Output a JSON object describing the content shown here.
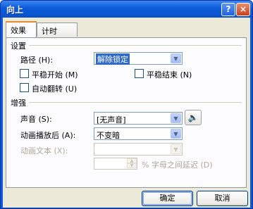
{
  "window": {
    "title": "向上",
    "help_label": "?",
    "close_label": "×"
  },
  "tabs": [
    {
      "label": "效果"
    },
    {
      "label": "计时"
    }
  ],
  "settings": {
    "group_label": "设置",
    "path_label": "路径 (H):",
    "path_value": "解除锁定",
    "smooth_start_label": "平稳开始 (M)",
    "smooth_end_label": "平稳结束 (N)",
    "auto_reverse_label": "自动翻转 (U)"
  },
  "enhance": {
    "group_label": "增强",
    "sound_label": "声音 (S):",
    "sound_value": "[无声音]",
    "after_anim_label": "动画播放后 (A):",
    "after_anim_value": "不变暗",
    "anim_text_label": "动画文本 (X):",
    "anim_text_value": "",
    "delay_value": "",
    "delay_suffix": "% 字母之间延迟 (D)"
  },
  "buttons": {
    "ok": "确定",
    "cancel": "取消"
  },
  "icons": {
    "sound": "speaker-icon",
    "dropdown": "chevron-down-icon"
  }
}
